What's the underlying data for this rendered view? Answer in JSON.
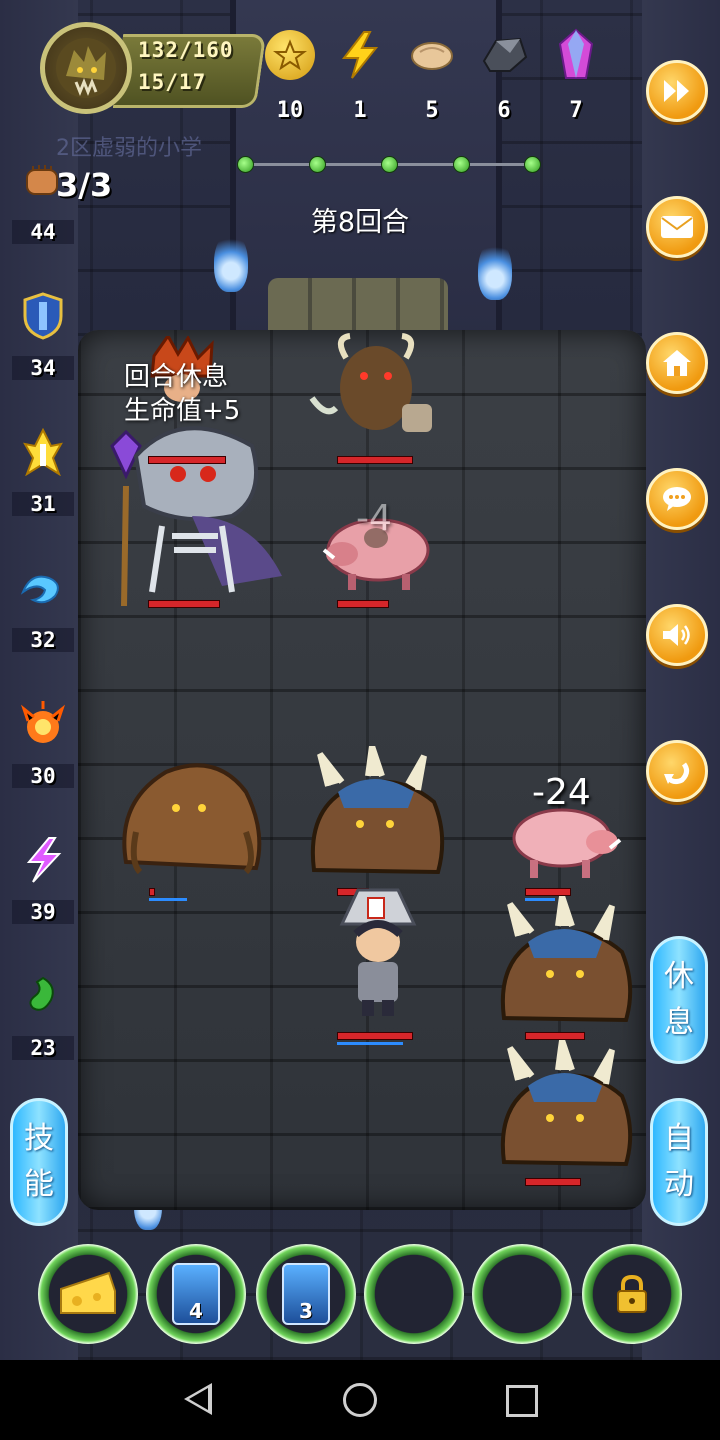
{
  "player": {
    "hp": "132/160",
    "level": "15/17",
    "avatar_icon": "dragon-avatar"
  },
  "resources": [
    {
      "name": "gold-coin-icon",
      "count": "10",
      "color": "#e8b01c"
    },
    {
      "name": "lightning-icon",
      "count": "1",
      "color": "#ffd21a"
    },
    {
      "name": "bread-icon",
      "count": "5",
      "color": "#e8c79a"
    },
    {
      "name": "iron-ore-icon",
      "count": "6",
      "color": "#6a6f7a"
    },
    {
      "name": "crystal-icon",
      "count": "7",
      "color": "#d44bd8"
    }
  ],
  "ghost_text": "2区虚弱的小学",
  "round": {
    "label": "第8回合",
    "nodes": 5
  },
  "energy": "3/3",
  "left_stats": [
    {
      "icon": "fist-icon",
      "value": "44"
    },
    {
      "icon": "shield-icon",
      "value": "34"
    },
    {
      "icon": "holy-light-icon",
      "value": "31"
    },
    {
      "icon": "water-icon",
      "value": "32"
    },
    {
      "icon": "fire-icon",
      "value": "30"
    },
    {
      "icon": "lightning-purple-icon",
      "value": "39"
    },
    {
      "icon": "poison-icon",
      "value": "23"
    }
  ],
  "rest_message": {
    "line1": "回合休息",
    "line2": "生命值+5"
  },
  "damage": {
    "pig_top": "-4",
    "pig_right": "-24"
  },
  "right_buttons": [
    "fast-forward-icon",
    "mail-icon",
    "home-icon",
    "chat-icon",
    "sound-icon",
    "undo-icon"
  ],
  "rest_button": {
    "line1": "休",
    "line2": "息"
  },
  "skill_button": {
    "line1": "技",
    "line2": "能"
  },
  "auto_button": {
    "line1": "自",
    "line2": "动"
  },
  "slots": [
    {
      "type": "cheese-icon"
    },
    {
      "type": "card-icon",
      "count": "4"
    },
    {
      "type": "card-icon",
      "count": "3"
    },
    {
      "type": "empty"
    },
    {
      "type": "empty"
    },
    {
      "type": "lock-icon"
    }
  ],
  "colors": {
    "accent": "#f09a10",
    "blue_button": "#2fb8ff",
    "hp": "#d6262a"
  }
}
